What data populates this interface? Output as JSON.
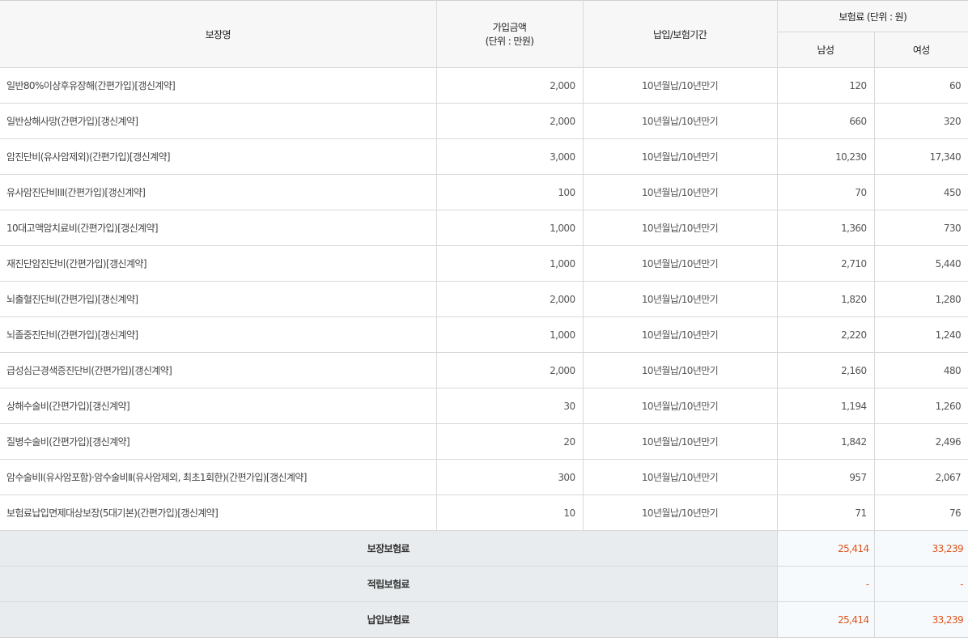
{
  "header": {
    "name": "보장명",
    "amount_line1": "가입금액",
    "amount_line2": "(단위 : 만원)",
    "period": "납입/보험기간",
    "premium": "보험료 (단위 : 원)",
    "male": "남성",
    "female": "여성"
  },
  "rows": [
    {
      "name": "일반80%이상후유장해(간편가입)[갱신계약]",
      "amount": "2,000",
      "period": "10년월납/10년만기",
      "male": "120",
      "female": "60"
    },
    {
      "name": "일반상해사망(간편가입)[갱신계약]",
      "amount": "2,000",
      "period": "10년월납/10년만기",
      "male": "660",
      "female": "320"
    },
    {
      "name": "암진단비(유사암제외)(간편가입)[갱신계약]",
      "amount": "3,000",
      "period": "10년월납/10년만기",
      "male": "10,230",
      "female": "17,340"
    },
    {
      "name": "유사암진단비III(간편가입)[갱신계약]",
      "amount": "100",
      "period": "10년월납/10년만기",
      "male": "70",
      "female": "450"
    },
    {
      "name": "10대고액암치료비(간편가입)[갱신계약]",
      "amount": "1,000",
      "period": "10년월납/10년만기",
      "male": "1,360",
      "female": "730"
    },
    {
      "name": "재진단암진단비(간편가입)[갱신계약]",
      "amount": "1,000",
      "period": "10년월납/10년만기",
      "male": "2,710",
      "female": "5,440"
    },
    {
      "name": "뇌출혈진단비(간편가입)[갱신계약]",
      "amount": "2,000",
      "period": "10년월납/10년만기",
      "male": "1,820",
      "female": "1,280"
    },
    {
      "name": "뇌졸중진단비(간편가입)[갱신계약]",
      "amount": "1,000",
      "period": "10년월납/10년만기",
      "male": "2,220",
      "female": "1,240"
    },
    {
      "name": "급성심근경색증진단비(간편가입)[갱신계약]",
      "amount": "2,000",
      "period": "10년월납/10년만기",
      "male": "2,160",
      "female": "480"
    },
    {
      "name": "상해수술비(간편가입)[갱신계약]",
      "amount": "30",
      "period": "10년월납/10년만기",
      "male": "1,194",
      "female": "1,260"
    },
    {
      "name": "질병수술비(간편가입)[갱신계약]",
      "amount": "20",
      "period": "10년월납/10년만기",
      "male": "1,842",
      "female": "2,496"
    },
    {
      "name": "암수술비Ⅰ(유사암포함)·암수술비Ⅱ(유사암제외, 최초1회한)(간편가입)[갱신계약]",
      "amount": "300",
      "period": "10년월납/10년만기",
      "male": "957",
      "female": "2,067"
    },
    {
      "name": "보험료납입면제대상보장(5대기본)(간편가입)[갱신계약]",
      "amount": "10",
      "period": "10년월납/10년만기",
      "male": "71",
      "female": "76"
    }
  ],
  "totals": [
    {
      "label": "보장보험료",
      "male": "25,414",
      "female": "33,239"
    },
    {
      "label": "적립보험료",
      "male": "-",
      "female": "-"
    },
    {
      "label": "납입보험료",
      "male": "25,414",
      "female": "33,239"
    }
  ],
  "colors": {
    "accent": "#e0541c",
    "header_bg": "#f7f7f7",
    "footer_label_bg": "#e8ecef"
  }
}
